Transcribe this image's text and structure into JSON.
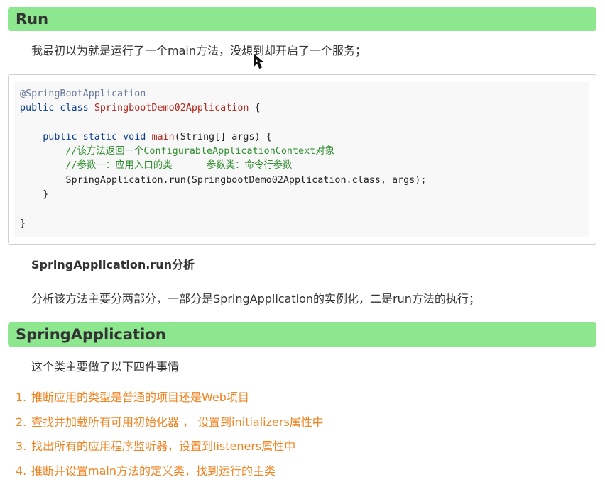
{
  "sections": {
    "run_title": "Run",
    "intro": "我最初以为就是运行了一个main方法，没想到却开启了一个服务；",
    "code_lines": [
      [
        {
          "t": "@SpringBootApplication",
          "c": "ann"
        }
      ],
      [
        {
          "t": "public class ",
          "c": "kw"
        },
        {
          "t": "SpringbootDemo02Application",
          "c": "tp"
        },
        {
          "t": " {",
          "c": "nm"
        }
      ],
      [],
      [
        {
          "t": "    public static void ",
          "c": "kw"
        },
        {
          "t": "main",
          "c": "tp"
        },
        {
          "t": "(String[] args) {",
          "c": "nm"
        }
      ],
      [
        {
          "t": "        //该方法返回一个ConfigurableApplicationContext对象",
          "c": "cm"
        }
      ],
      [
        {
          "t": "        //参数一：应用入口的类      参数类：命令行参数",
          "c": "cm"
        }
      ],
      [
        {
          "t": "        SpringApplication.run(SpringbootDemo02Application.class, args);",
          "c": "nm"
        }
      ],
      [
        {
          "t": "    }",
          "c": "nm"
        }
      ],
      [],
      [
        {
          "t": "}",
          "c": "nm"
        }
      ]
    ],
    "analysis_heading": "SpringApplication.run分析",
    "analysis_text": "分析该方法主要分两部分，一部分是SpringApplication的实例化，二是run方法的执行；",
    "springapp_title": "SpringApplication",
    "springapp_intro": "这个类主要做了以下四件事情",
    "steps": [
      {
        "num": "1.",
        "text": "推断应用的类型是普通的项目还是Web项目"
      },
      {
        "num": "2.",
        "text": "查找并加载所有可用初始化器 ， 设置到initializers属性中"
      },
      {
        "num": "3.",
        "text": "找出所有的应用程序监听器，设置到listeners属性中"
      },
      {
        "num": "4.",
        "text": "推断并设置main方法的定义类，找到运行的主类"
      }
    ]
  },
  "colors": {
    "heading_bar": "#8ce78e",
    "list_text": "#f08322"
  },
  "icons": {
    "cursor": "mouse-pointer-icon"
  }
}
